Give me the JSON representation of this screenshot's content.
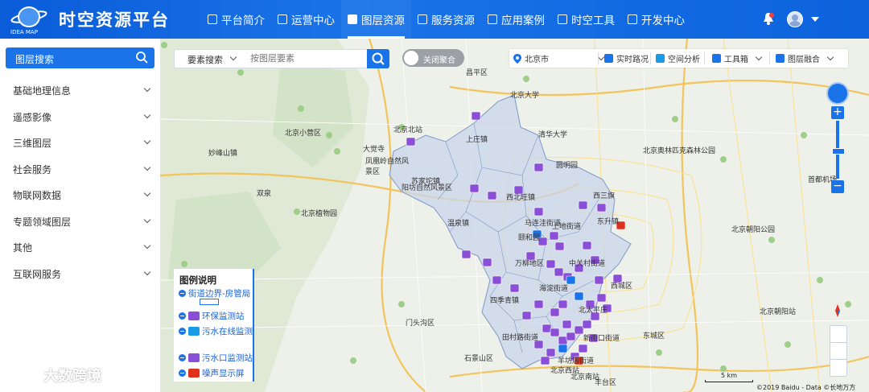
{
  "header": {
    "brand": "时空资源平台",
    "logo_sub": "IDEA MAP",
    "nav": [
      {
        "label": "平台简介",
        "icon": "monitor-icon"
      },
      {
        "label": "运营中心",
        "icon": "home-icon"
      },
      {
        "label": "图层资源",
        "icon": "layers-icon",
        "active": true
      },
      {
        "label": "服务资源",
        "icon": "bookmark-icon"
      },
      {
        "label": "应用案例",
        "icon": "grid-icon"
      },
      {
        "label": "时空工具",
        "icon": "chart-icon"
      },
      {
        "label": "开发中心",
        "icon": "calendar-icon"
      }
    ]
  },
  "sidebar": {
    "search_label": "图层搜索",
    "items": [
      {
        "label": "基础地理信息"
      },
      {
        "label": "遥感影像"
      },
      {
        "label": "三维图层"
      },
      {
        "label": "社会服务"
      },
      {
        "label": "物联网数据"
      },
      {
        "label": "专题领域图层"
      },
      {
        "label": "其他"
      },
      {
        "label": "互联网服务"
      }
    ]
  },
  "map_search": {
    "type_label": "要素搜索",
    "placeholder": "按图层要素",
    "toggle_label": "关闭聚合"
  },
  "toolbar": {
    "city": "北京市",
    "traffic": "实时路况",
    "spatial": "空间分析",
    "toolbox": "工具箱",
    "layer_fusion": "图层融合"
  },
  "legend": {
    "title": "图例说明",
    "items": [
      {
        "label": "街道边界-房管局",
        "color": "#1a73e8"
      },
      {
        "label": "环保监测站",
        "color": "#8a4fd6"
      },
      {
        "label": "污水在线监测",
        "color": "#1a9be8"
      },
      {
        "label": "污水口监测站",
        "color": "#8a4fd6"
      },
      {
        "label": "噪声显示屏",
        "color": "#e0301e"
      }
    ]
  },
  "map_labels": [
    "北京北站",
    "北京小营区",
    "大觉寺",
    "凤凰岭自然风景区",
    "苏家坨镇",
    "上庄镇",
    "阳坊自然风景区",
    "西北旺镇",
    "温泉镇",
    "西三旗",
    "马连洼街道",
    "上地街道",
    "东升镇",
    "万柳地区",
    "海淀街道",
    "中关村街道",
    "四季青镇",
    "田村路街道",
    "北太平庄",
    "羊坊店街道",
    "新街口街道",
    "石景山区",
    "妙峰山镇",
    "北京植物园",
    "双泉",
    "清华大学",
    "北京大学",
    "圆明园",
    "颐和园",
    "昌平区",
    "北京奥林匹克森林公园",
    "北京朝阳公园",
    "首都机场",
    "北京朝阳站",
    "东城区",
    "西城区",
    "丰台区",
    "门头沟区",
    "北京西站",
    "北京南站"
  ],
  "scale_label": "5 km",
  "copyright": "©2019 Baidu - Data ©长地万方",
  "watermark": "大数跨境",
  "colors": {
    "primary": "#1a73e8",
    "marker": "#8a4fd6",
    "noise": "#e0301e"
  }
}
